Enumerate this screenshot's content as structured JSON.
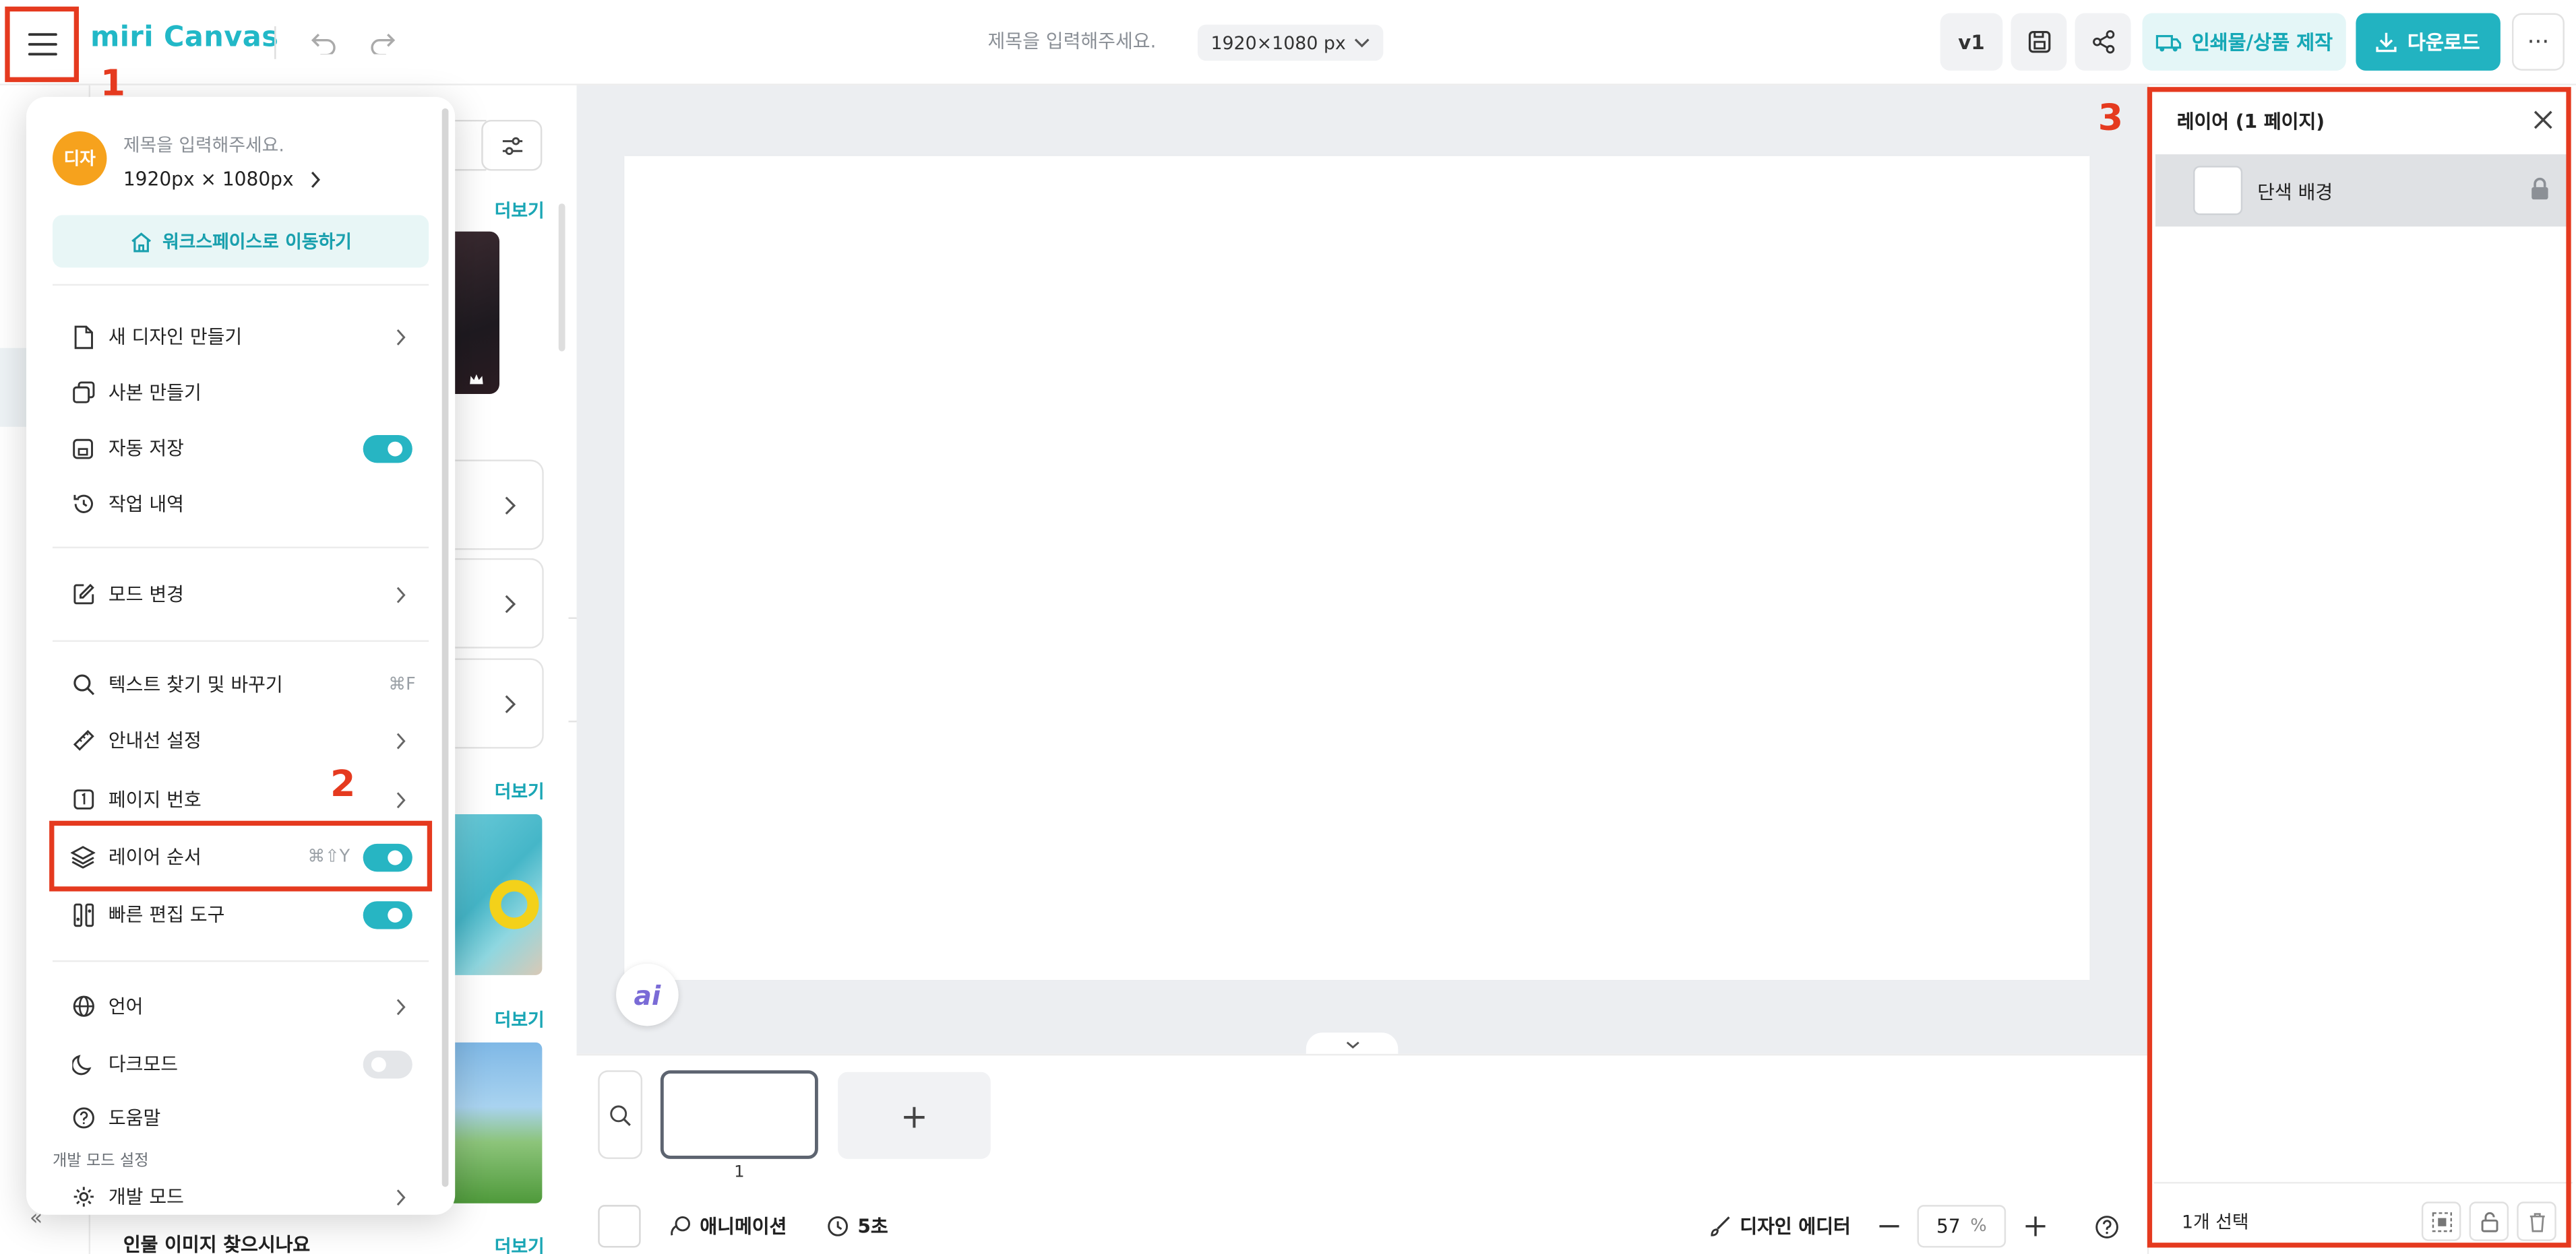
{
  "app": {
    "logo_text": "miri Canvas",
    "title_placeholder": "제목을 입력해주세요.",
    "canvas_size": "1920×1080 px",
    "version": "v1",
    "print_button": "인쇄물/상품 제작",
    "download_button": "다운로드",
    "more_button": "···"
  },
  "menu": {
    "avatar_text": "디자",
    "doc_title": "제목을 입력해주세요.",
    "doc_size": "1920px × 1080px",
    "workspace_button": "워크스페이스로 이동하기",
    "items": [
      {
        "label": "새 디자인 만들기"
      },
      {
        "label": "사본 만들기"
      },
      {
        "label": "자동 저장"
      },
      {
        "label": "작업 내역"
      },
      {
        "label": "모드 변경"
      },
      {
        "label": "텍스트 찾기 및 바꾸기",
        "shortcut": "⌘F"
      },
      {
        "label": "안내선 설정"
      },
      {
        "label": "페이지 번호"
      },
      {
        "label": "레이어 순서",
        "shortcut": "⌘⇧Y"
      },
      {
        "label": "빠른 편집 도구"
      },
      {
        "label": "언어"
      },
      {
        "label": "다크모드"
      },
      {
        "label": "도움말"
      },
      {
        "label": "개발 모드"
      }
    ],
    "toggles": {
      "auto_save": true,
      "layer_order": true,
      "quick_edit": true,
      "dark_mode": false
    },
    "dev_section_caption": "개발 모드 설정"
  },
  "side_panel": {
    "more_label": "더보기",
    "bottom_heading": "인물 이미지 찾으시나요"
  },
  "editor": {
    "page_number": "1",
    "add_page": "+",
    "animation": "애니메이션",
    "duration": "5초",
    "design_editor": "디자인 에디터",
    "zoom_value": "57",
    "zoom_unit": "%"
  },
  "layers_panel": {
    "title": "레이어 (1 페이지)",
    "layers": [
      {
        "name": "단색 배경",
        "locked": true
      }
    ],
    "selection_count": "1개 선택"
  },
  "annotations": {
    "one": "1",
    "two": "2",
    "three": "3"
  },
  "colors": {
    "brand": "#22b3c1",
    "highlight": "#e53a1f",
    "avatar": "#f6a21d"
  }
}
